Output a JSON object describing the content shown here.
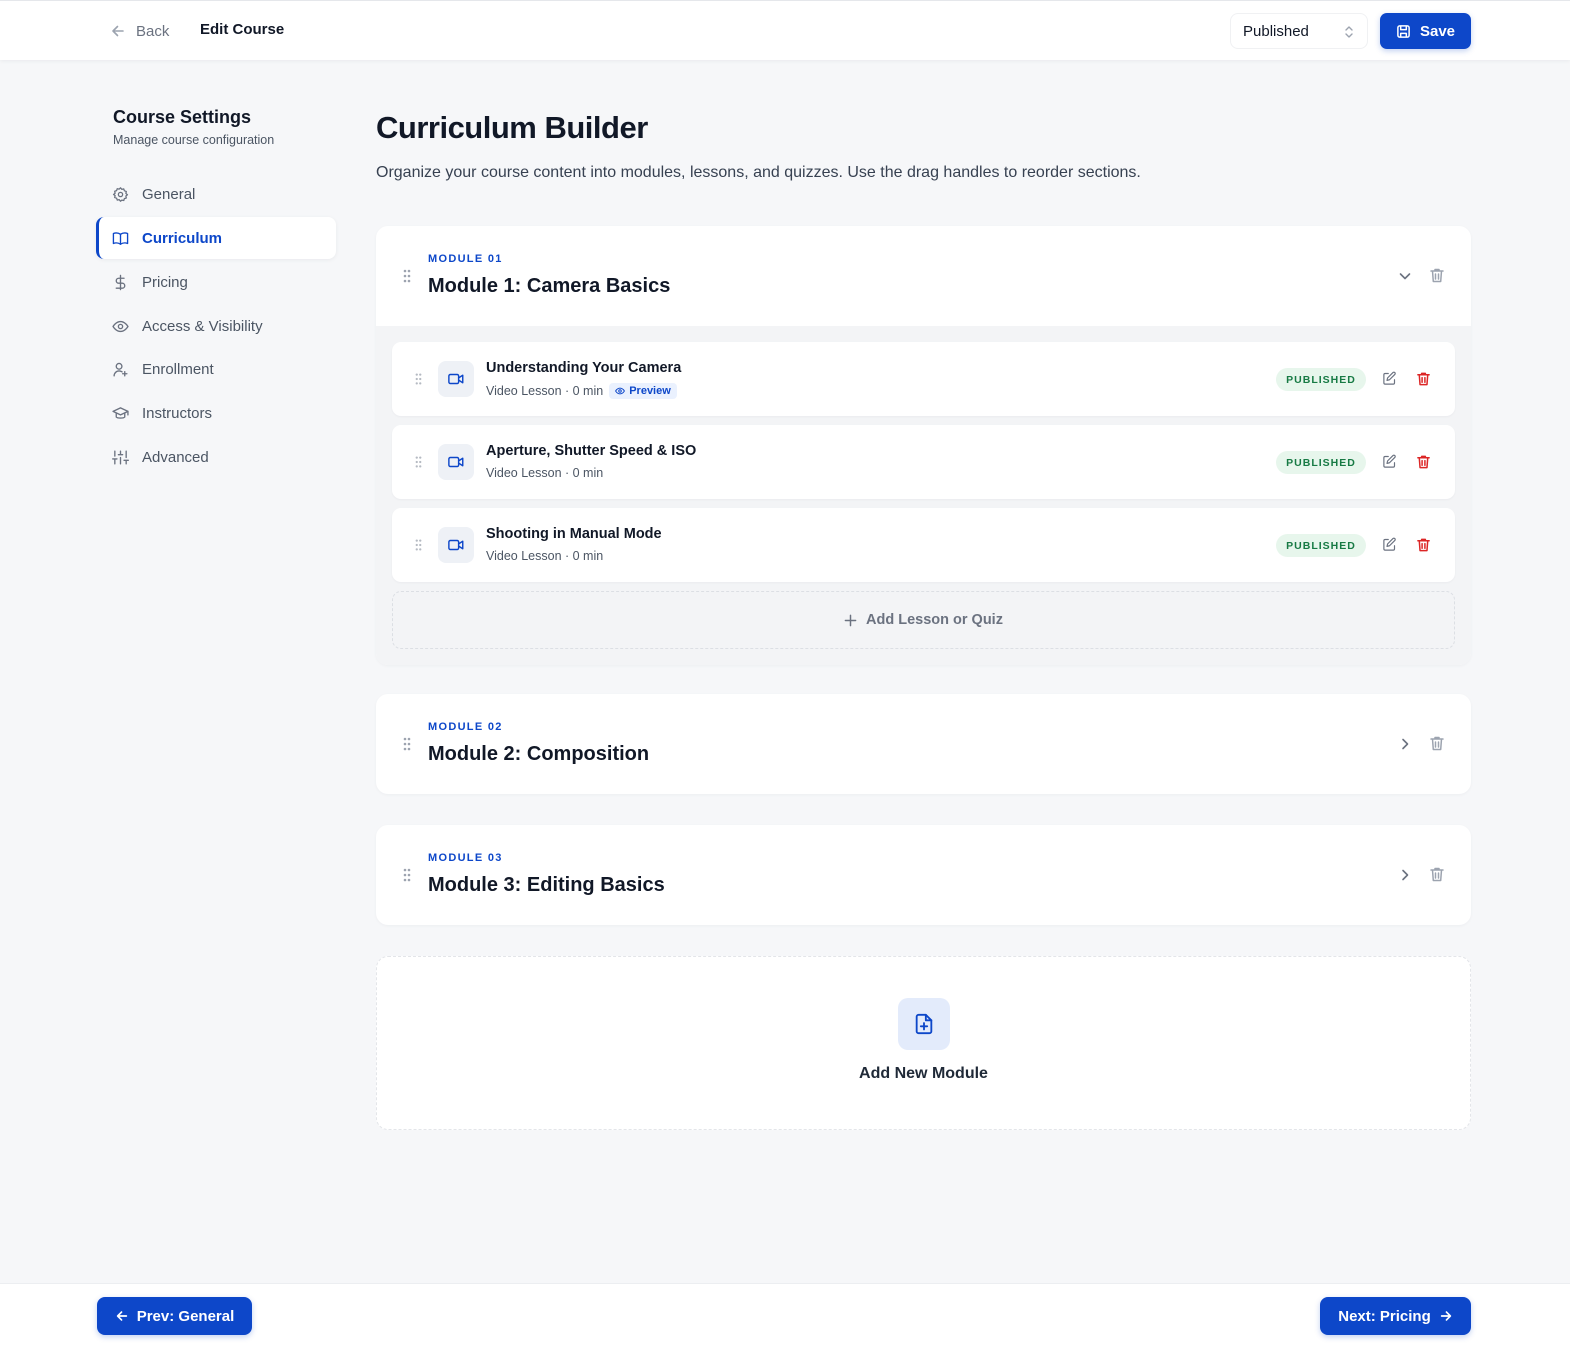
{
  "header": {
    "back_label": "Back",
    "title": "Edit Course",
    "status_value": "Published",
    "save_label": "Save"
  },
  "sidebar": {
    "title": "Course Settings",
    "subtitle": "Manage course configuration",
    "active_item": "Curriculum",
    "items": [
      {
        "label": "General",
        "icon": "gear-icon"
      },
      {
        "label": "Curriculum",
        "icon": "book-icon"
      },
      {
        "label": "Pricing",
        "icon": "dollar-icon"
      },
      {
        "label": "Access & Visibility",
        "icon": "eye-icon"
      },
      {
        "label": "Enrollment",
        "icon": "user-plus-icon"
      },
      {
        "label": "Instructors",
        "icon": "graduation-cap-icon"
      },
      {
        "label": "Advanced",
        "icon": "sliders-icon"
      }
    ]
  },
  "main": {
    "title": "Curriculum Builder",
    "description": "Organize your course content into modules, lessons, and quizzes. Use the drag handles to reorder sections.",
    "modules": [
      {
        "kicker": "MODULE 01",
        "title": "Module 1: Camera Basics",
        "expanded": true,
        "lessons": [
          {
            "title": "Understanding Your Camera",
            "meta": "Video Lesson · 0 min",
            "preview_label": "Preview",
            "status": "PUBLISHED"
          },
          {
            "title": "Aperture, Shutter Speed & ISO",
            "meta": "Video Lesson · 0 min",
            "status": "PUBLISHED"
          },
          {
            "title": "Shooting in Manual Mode",
            "meta": "Video Lesson · 0 min",
            "status": "PUBLISHED"
          }
        ],
        "add_lesson_label": "Add Lesson or Quiz"
      },
      {
        "kicker": "MODULE 02",
        "title": "Module 2: Composition",
        "expanded": false
      },
      {
        "kicker": "MODULE 03",
        "title": "Module 3: Editing Basics",
        "expanded": false
      }
    ],
    "add_module_label": "Add New Module"
  },
  "footer": {
    "prev_label": "Prev: General",
    "next_label": "Next: Pricing"
  },
  "colors": {
    "accent": "#0d47c9",
    "published_bg": "#e7f6ec",
    "published_text": "#177a44",
    "danger": "#dc2626",
    "page_bg": "#f6f7f9"
  }
}
